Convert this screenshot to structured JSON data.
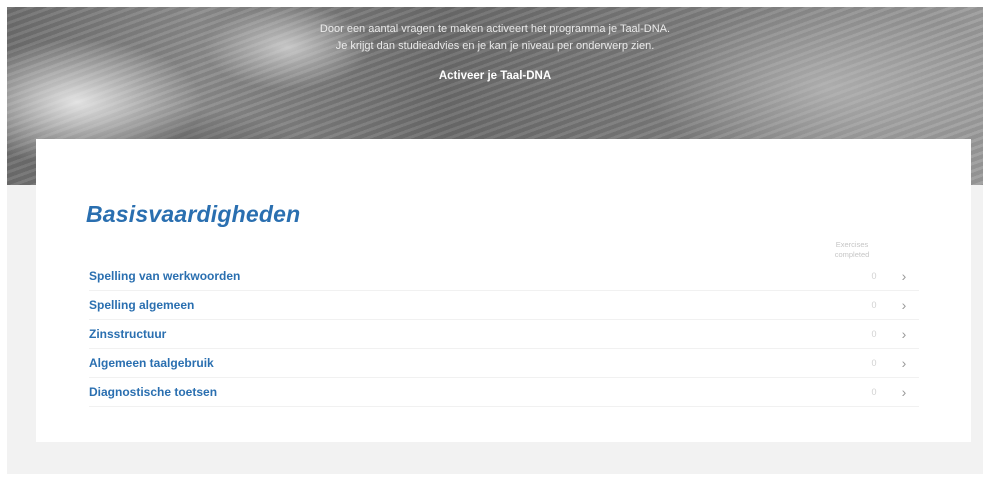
{
  "hero": {
    "line1": "Door een aantal vragen te maken activeert het programma je Taal-DNA.",
    "line2": "Je krijgt dan studieadvies en je kan je niveau per onderwerp zien.",
    "activate_label": "Activeer je Taal-DNA"
  },
  "section": {
    "title": "Basisvaardigheden",
    "column_header_line1": "Exercises",
    "column_header_line2": "completed",
    "topics": [
      {
        "label": "Spelling van werkwoorden",
        "completed": "0"
      },
      {
        "label": "Spelling algemeen",
        "completed": "0"
      },
      {
        "label": "Zinsstructuur",
        "completed": "0"
      },
      {
        "label": "Algemeen taalgebruik",
        "completed": "0"
      },
      {
        "label": "Diagnostische toetsen",
        "completed": "0"
      }
    ],
    "chevron_icon": "chevron-right-icon"
  }
}
